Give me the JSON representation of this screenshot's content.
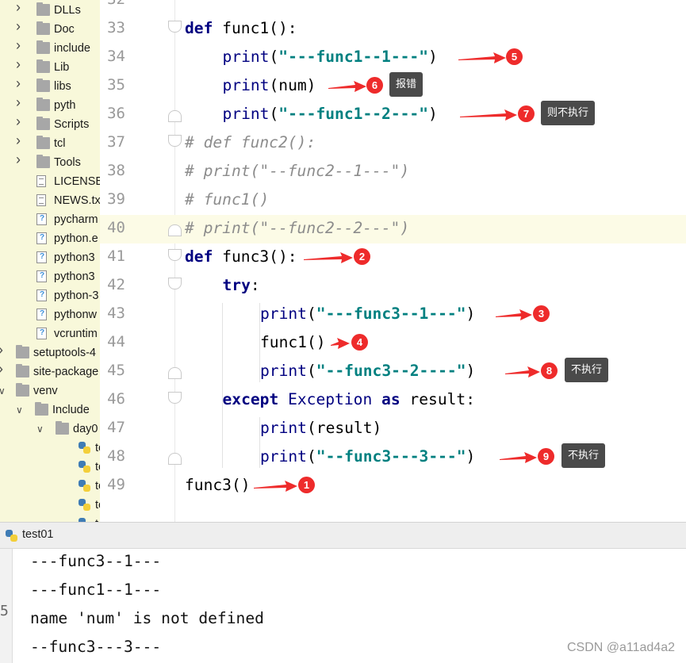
{
  "tree": {
    "items": [
      {
        "label": "DLLs",
        "type": "folder",
        "expand": "collapsed"
      },
      {
        "label": "Doc",
        "type": "folder",
        "expand": "collapsed"
      },
      {
        "label": "include",
        "type": "folder",
        "expand": "collapsed"
      },
      {
        "label": "Lib",
        "type": "folder",
        "expand": "collapsed"
      },
      {
        "label": "libs",
        "type": "folder",
        "expand": "collapsed"
      },
      {
        "label": "pyth",
        "type": "folder",
        "expand": "collapsed"
      },
      {
        "label": "Scripts",
        "type": "folder",
        "expand": "collapsed"
      },
      {
        "label": "tcl",
        "type": "folder",
        "expand": "collapsed"
      },
      {
        "label": "Tools",
        "type": "folder",
        "expand": "collapsed"
      },
      {
        "label": "LICENSE.",
        "type": "file"
      },
      {
        "label": "NEWS.tx",
        "type": "file"
      },
      {
        "label": "pycharm",
        "type": "unknown-file"
      },
      {
        "label": "python.e",
        "type": "unknown-file"
      },
      {
        "label": "python3",
        "type": "unknown-file"
      },
      {
        "label": "python3",
        "type": "unknown-file"
      },
      {
        "label": "python-3",
        "type": "unknown-file"
      },
      {
        "label": "pythonw",
        "type": "unknown-file"
      },
      {
        "label": "vcruntim",
        "type": "unknown-file"
      },
      {
        "label": "setuptools-4",
        "type": "folder",
        "expand": "collapsed"
      },
      {
        "label": "site-package",
        "type": "folder",
        "expand": "collapsed"
      },
      {
        "label": "venv",
        "type": "folder",
        "expand": "expanded"
      },
      {
        "label": "Include",
        "type": "folder",
        "expand": "expanded"
      },
      {
        "label": "day0",
        "type": "folder",
        "expand": "expanded"
      },
      {
        "label": "te",
        "type": "python-file"
      },
      {
        "label": "te",
        "type": "python-file"
      },
      {
        "label": "te",
        "type": "python-file"
      },
      {
        "label": "te",
        "type": "python-file"
      },
      {
        "label": "t",
        "type": "python-file"
      }
    ]
  },
  "editor": {
    "lines": [
      {
        "num": "32",
        "code": [],
        "fold": ""
      },
      {
        "num": "33",
        "indent": 0,
        "fold": "down",
        "code": [
          [
            "kw",
            "def"
          ],
          [
            "fn",
            " func1():"
          ]
        ]
      },
      {
        "num": "34",
        "indent": 1,
        "fold": "",
        "code": [
          [
            "bi",
            "print"
          ],
          [
            "fn",
            "("
          ],
          [
            "str",
            "\"---func1--1---\""
          ],
          [
            "fn",
            ")"
          ]
        ]
      },
      {
        "num": "35",
        "indent": 1,
        "fold": "",
        "code": [
          [
            "bi",
            "print"
          ],
          [
            "fn",
            "(num)"
          ]
        ]
      },
      {
        "num": "36",
        "indent": 1,
        "fold": "up",
        "code": [
          [
            "bi",
            "print"
          ],
          [
            "fn",
            "("
          ],
          [
            "str",
            "\"---func1--2---\""
          ],
          [
            "fn",
            ")"
          ]
        ]
      },
      {
        "num": "37",
        "indent": 0,
        "fold": "down",
        "code": [
          [
            "cmt",
            "# def func2():"
          ]
        ]
      },
      {
        "num": "38",
        "indent": 0,
        "fold": "",
        "code": [
          [
            "cmt",
            "# print(\"--func2--1---\")"
          ]
        ]
      },
      {
        "num": "39",
        "indent": 0,
        "fold": "",
        "code": [
          [
            "cmt",
            "# func1()"
          ]
        ]
      },
      {
        "num": "40",
        "indent": 0,
        "fold": "up",
        "code": [
          [
            "cmt",
            "# print(\"--func2--2---\")"
          ]
        ]
      },
      {
        "num": "41",
        "indent": 0,
        "fold": "down",
        "code": [
          [
            "kw",
            "def"
          ],
          [
            "fn",
            " func3():"
          ]
        ]
      },
      {
        "num": "42",
        "indent": 1,
        "fold": "down",
        "code": [
          [
            "kw",
            "try"
          ],
          [
            "fn",
            ":"
          ]
        ]
      },
      {
        "num": "43",
        "indent": 2,
        "fold": "",
        "code": [
          [
            "bi",
            "print"
          ],
          [
            "fn",
            "("
          ],
          [
            "str",
            "\"---func3--1---\""
          ],
          [
            "fn",
            ")"
          ]
        ]
      },
      {
        "num": "44",
        "indent": 2,
        "fold": "",
        "code": [
          [
            "fn",
            "func1()"
          ]
        ]
      },
      {
        "num": "45",
        "indent": 2,
        "fold": "up",
        "code": [
          [
            "bi",
            "print"
          ],
          [
            "fn",
            "("
          ],
          [
            "str",
            "\"--func3--2----\""
          ],
          [
            "fn",
            ")"
          ]
        ]
      },
      {
        "num": "46",
        "indent": 1,
        "fold": "down",
        "code": [
          [
            "kw",
            "except"
          ],
          [
            "fn",
            " "
          ],
          [
            "bi",
            "Exception"
          ],
          [
            "fn",
            " "
          ],
          [
            "kw",
            "as"
          ],
          [
            "fn",
            " result:"
          ]
        ]
      },
      {
        "num": "47",
        "indent": 2,
        "fold": "",
        "code": [
          [
            "bi",
            "print"
          ],
          [
            "fn",
            "(result)"
          ]
        ]
      },
      {
        "num": "48",
        "indent": 2,
        "fold": "up",
        "code": [
          [
            "bi",
            "print"
          ],
          [
            "fn",
            "("
          ],
          [
            "str",
            "\"--func3---3---\""
          ],
          [
            "fn",
            ")"
          ]
        ]
      },
      {
        "num": "49",
        "indent": 0,
        "fold": "",
        "code": [
          [
            "fn",
            "func3()"
          ]
        ]
      }
    ],
    "highlighted_line": "40"
  },
  "annotations": [
    {
      "line": "34",
      "badge": "5",
      "tooltip": ""
    },
    {
      "line": "35",
      "badge": "6",
      "tooltip": "报错"
    },
    {
      "line": "36",
      "badge": "7",
      "tooltip": "则不执行"
    },
    {
      "line": "41",
      "badge": "2",
      "tooltip": ""
    },
    {
      "line": "43",
      "badge": "3",
      "tooltip": ""
    },
    {
      "line": "44",
      "badge": "4",
      "tooltip": ""
    },
    {
      "line": "45",
      "badge": "8",
      "tooltip": "不执行"
    },
    {
      "line": "48",
      "badge": "9",
      "tooltip": "不执行"
    },
    {
      "line": "49",
      "badge": "1",
      "tooltip": ""
    }
  ],
  "run": {
    "tab_label": "test01",
    "side_mark": "5",
    "output": [
      "---func3--1---",
      "---func1--1---",
      "name 'num' is not defined",
      "--func3---3---"
    ]
  },
  "watermark": "CSDN @a11ad4a2",
  "colors": {
    "tree_bg": "#f8f8da",
    "keyword": "#000080",
    "string": "#008080",
    "comment": "#8c8c8c",
    "annotation_red": "#ee2b2b",
    "tooltip_bg": "#4a4a4a",
    "line_highlight": "#fcfbe6"
  }
}
